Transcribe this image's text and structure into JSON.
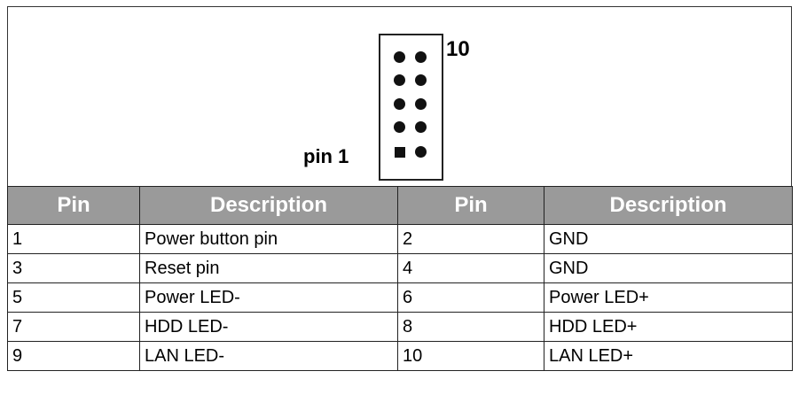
{
  "diagram": {
    "label_top": "10",
    "label_pin1": "pin 1"
  },
  "table": {
    "headers": [
      "Pin",
      "Description",
      "Pin",
      "Description"
    ],
    "rows": [
      [
        "1",
        "Power button pin",
        "2",
        "GND"
      ],
      [
        "3",
        "Reset pin",
        "4",
        "GND"
      ],
      [
        "5",
        "Power LED-",
        "6",
        "Power LED+"
      ],
      [
        "7",
        "HDD LED-",
        "8",
        "HDD LED+"
      ],
      [
        "9",
        "LAN LED-",
        "10",
        "LAN LED+"
      ]
    ]
  }
}
